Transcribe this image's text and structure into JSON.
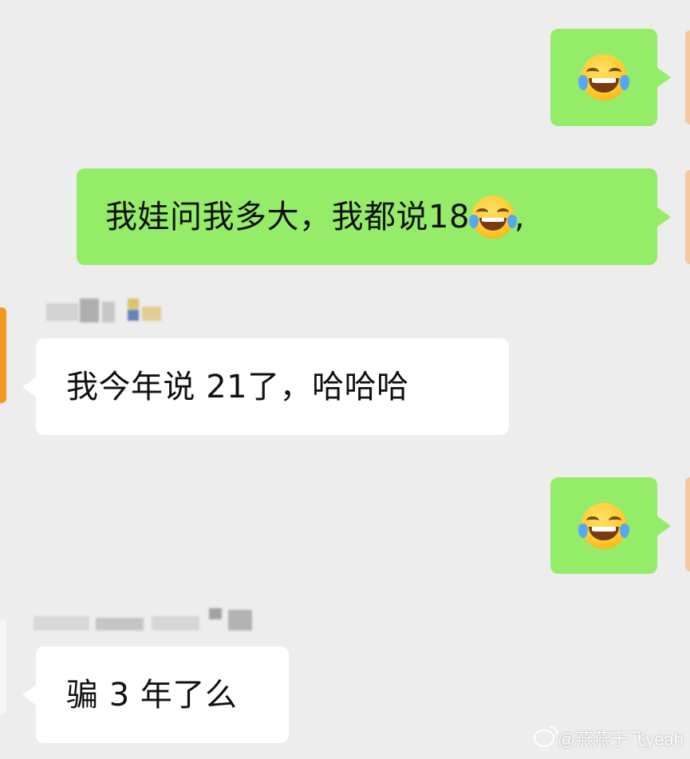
{
  "messages": [
    {
      "id": "m1",
      "direction": "sent",
      "type": "emoji",
      "emoji": "face-with-tears-of-joy"
    },
    {
      "id": "m2",
      "direction": "sent",
      "type": "text",
      "text": "我娃问我多大，我都说18",
      "trailing_emoji": "face-with-tears-of-joy",
      "trailing_text": ","
    },
    {
      "id": "m3",
      "direction": "received",
      "type": "text",
      "sender": "(blurred)",
      "text": "我今年说 21了，哈哈哈"
    },
    {
      "id": "m4",
      "direction": "sent",
      "type": "emoji",
      "emoji": "face-with-tears-of-joy"
    },
    {
      "id": "m5",
      "direction": "received",
      "type": "text",
      "sender": "(blurred)",
      "text": "骗 3 年了么"
    }
  ],
  "watermark": {
    "text": "@燕燕于飞yeah",
    "icon": "weibo-icon"
  },
  "colors": {
    "background": "#ededed",
    "sent_bubble": "#95ec69",
    "received_bubble": "#ffffff",
    "avatar_orange": "#f39a1e"
  }
}
